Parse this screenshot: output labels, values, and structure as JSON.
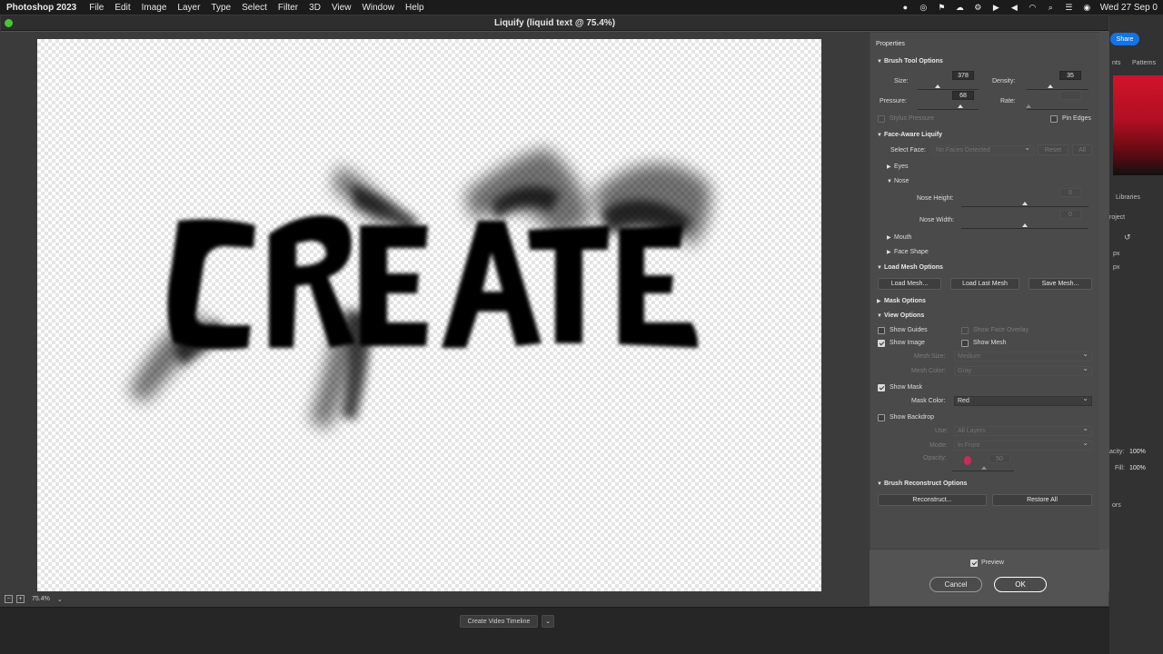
{
  "menubar": {
    "app": "Photoshop 2023",
    "items": [
      "File",
      "Edit",
      "Image",
      "Layer",
      "Type",
      "Select",
      "Filter",
      "3D",
      "View",
      "Window",
      "Help"
    ],
    "clock": "Wed 27 Sep 0"
  },
  "window": {
    "title": "Liquify (liquid text @ 75.4%)",
    "zoom": "75.4%"
  },
  "canvas": {
    "text": "CREATE"
  },
  "properties": {
    "title": "Properties",
    "brush_tool": {
      "header": "Brush Tool Options",
      "size_label": "Size:",
      "size": "378",
      "density_label": "Density:",
      "density": "35",
      "pressure_label": "Pressure:",
      "pressure": "68",
      "rate_label": "Rate:",
      "rate": "",
      "stylus_label": "Stylus Pressure",
      "pin_edges_label": "Pin Edges"
    },
    "face_aware": {
      "header": "Face-Aware Liquify",
      "select_face_label": "Select Face:",
      "select_face_value": "No Faces Detected",
      "reset_label": "Reset",
      "all_label": "All",
      "eyes": "Eyes",
      "nose": "Nose",
      "nose_height": "Nose Height:",
      "nose_width": "Nose Width:",
      "nose_height_value": "0",
      "nose_width_value": "0",
      "mouth": "Mouth",
      "face_shape": "Face Shape"
    },
    "mesh": {
      "header": "Load Mesh Options",
      "load": "Load Mesh...",
      "load_last": "Load Last Mesh",
      "save": "Save Mesh..."
    },
    "mask_options": {
      "header": "Mask Options"
    },
    "view": {
      "header": "View Options",
      "show_guides": "Show Guides",
      "show_face_overlay": "Show Face Overlay",
      "show_image": "Show Image",
      "show_mesh": "Show Mesh",
      "mesh_size_label": "Mesh Size:",
      "mesh_size": "Medium",
      "mesh_color_label": "Mesh Color:",
      "mesh_color": "Gray",
      "show_mask": "Show Mask",
      "mask_color_label": "Mask Color:",
      "mask_color": "Red",
      "show_backdrop": "Show Backdrop",
      "use_label": "Use:",
      "use_value": "All Layers",
      "mode_label": "Mode:",
      "mode_value": "In Front",
      "opacity_label": "Opacity:",
      "opacity_value": "50"
    },
    "reconstruct": {
      "header": "Brush Reconstruct Options",
      "reconstruct": "Reconstruct...",
      "restore": "Restore All"
    },
    "preview": "Preview",
    "cancel": "Cancel",
    "ok": "OK"
  },
  "background": {
    "share": "Share",
    "tab1": "nts",
    "tab2": "Patterns",
    "libraries": "Libraries",
    "project": "roject",
    "px1": "px",
    "px2": "px",
    "opacity_label": "acity:",
    "opacity": "100%",
    "fill_label": "Fill:",
    "fill": "100%",
    "ors": "ors",
    "timeline": "Create Video Timeline"
  },
  "colors": {
    "accent_blue": "#1473e6",
    "mask_cursor": "#e0245e"
  }
}
